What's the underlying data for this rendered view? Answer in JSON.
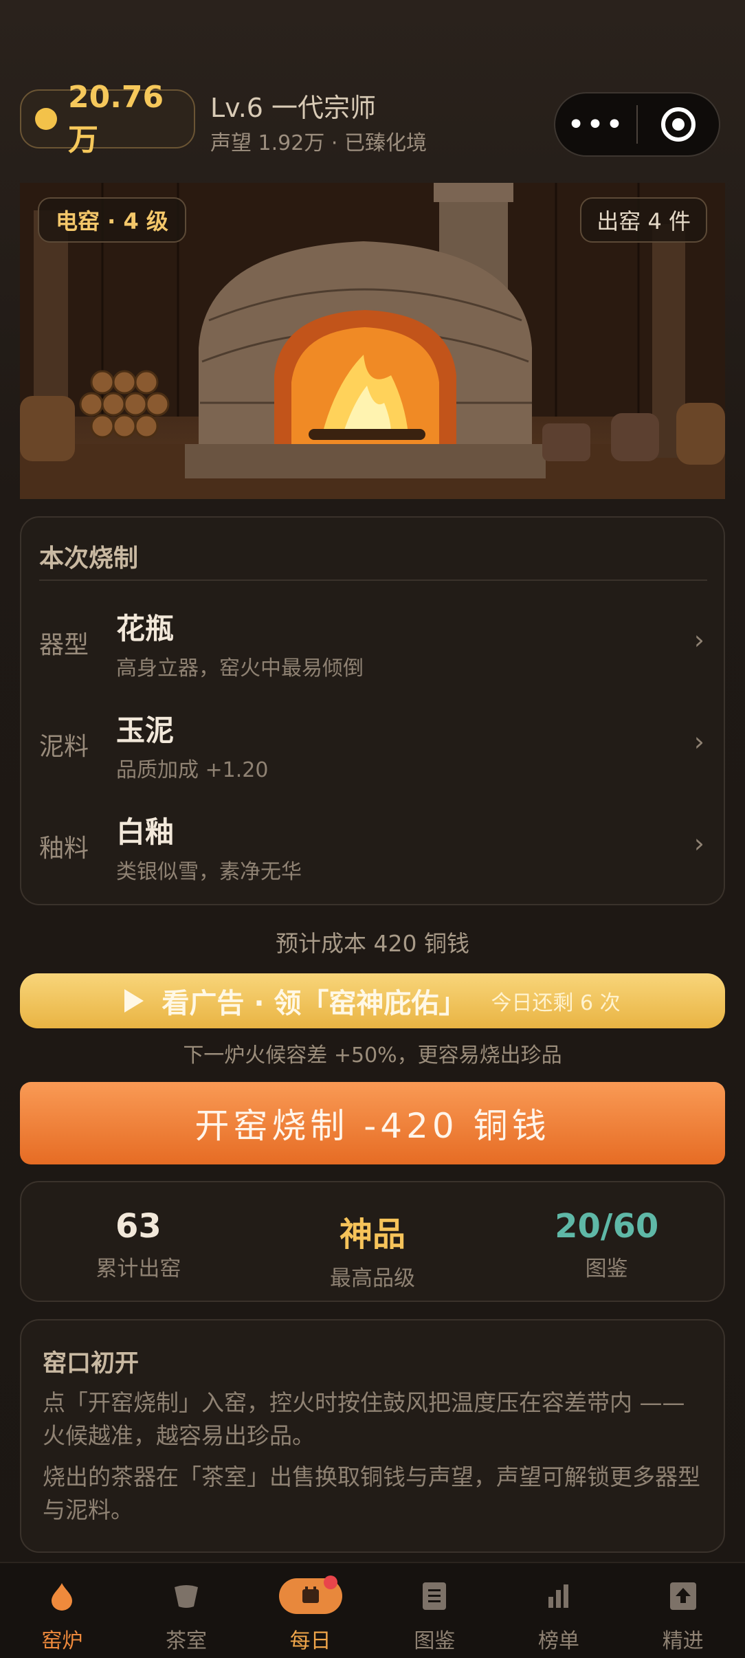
{
  "header": {
    "coins": "20.76万",
    "level": "Lv.6 一代宗师",
    "reputation": "声望 1.92万 · 已臻化境",
    "menu_more": "•••"
  },
  "hero": {
    "kiln_tag": "电窑 · 4 级",
    "output_tag": "出窑 4 件"
  },
  "config": {
    "title": "本次烧制",
    "rows": [
      {
        "key": "器型",
        "value": "花瓶",
        "desc": "高身立器，窑火中最易倾倒"
      },
      {
        "key": "泥料",
        "value": "玉泥",
        "desc": "品质加成 +1.20"
      },
      {
        "key": "釉料",
        "value": "白釉",
        "desc": "类银似雪，素净无华"
      }
    ],
    "chevron": "›"
  },
  "cost_text": "预计成本 420 铜钱",
  "ad": {
    "main": "看广告 · 领「窑神庇佑」",
    "remaining": "今日还剩 6 次",
    "note": "下一炉火候容差 +50%，更容易烧出珍品"
  },
  "fire_button": "开窑烧制  -420 铜钱",
  "stats": [
    {
      "value": "63",
      "label": "累计出窑",
      "color": "#f2e8da"
    },
    {
      "value": "神品",
      "label": "最高品级",
      "color": "#f6c35a"
    },
    {
      "value": "20/60",
      "label": "图鉴",
      "color": "#5fb8a7"
    }
  ],
  "tips": {
    "title": "窑口初开",
    "p1": "点「开窑烧制」入窑，控火时按住鼓风把温度压在容差带内 —— 火候越准，越容易出珍品。",
    "p2": "烧出的茶器在「茶室」出售换取铜钱与声望，声望可解锁更多器型与泥料。"
  },
  "tabs": [
    {
      "label": "窑炉",
      "icon": "flame-icon"
    },
    {
      "label": "茶室",
      "icon": "cup-icon"
    },
    {
      "label": "每日",
      "icon": "calendar-icon"
    },
    {
      "label": "图鉴",
      "icon": "book-icon"
    },
    {
      "label": "榜单",
      "icon": "bar-chart-icon"
    },
    {
      "label": "精进",
      "icon": "upgrade-icon"
    }
  ],
  "colors": {
    "accent_orange": "#ef8a3c",
    "gold": "#f6c85b",
    "teal": "#5fb8a7",
    "badge_red": "#e9454b"
  }
}
